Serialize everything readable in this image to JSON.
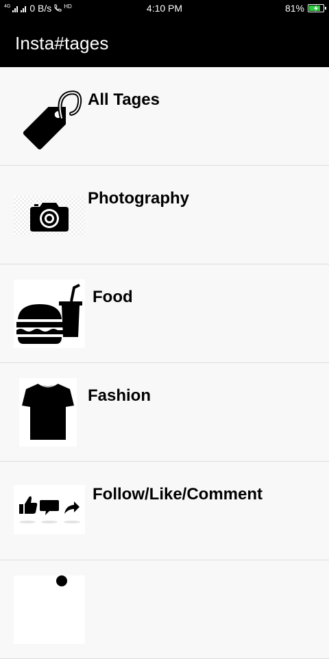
{
  "status_bar": {
    "network": "4G",
    "speed": "0 B/s",
    "hd": "HD",
    "time": "4:10 PM",
    "battery": "81%",
    "battery_level": 0.81
  },
  "app_bar": {
    "title": "Insta#tages"
  },
  "categories": [
    {
      "label": "All Tages",
      "icon": "tag-icon"
    },
    {
      "label": "Photography",
      "icon": "camera-icon"
    },
    {
      "label": "Food",
      "icon": "burger-drink-icon"
    },
    {
      "label": "Fashion",
      "icon": "tshirt-icon"
    },
    {
      "label": "Follow/Like/Comment",
      "icon": "social-actions-icon"
    },
    {
      "label": "",
      "icon": "person-icon"
    }
  ]
}
